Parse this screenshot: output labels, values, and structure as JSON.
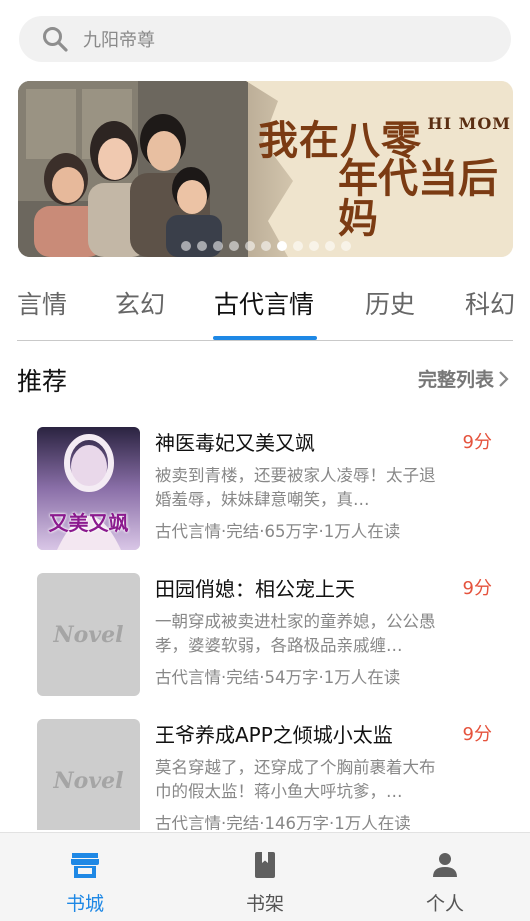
{
  "search": {
    "placeholder": "九阳帝尊",
    "icon": "search-icon"
  },
  "banner": {
    "title_line1": "我在八零",
    "title_line2": "年代当后妈",
    "subtitle": "HI MOM",
    "dots_count": 11,
    "active_dot": 6
  },
  "tabs": [
    {
      "label": "言情"
    },
    {
      "label": "玄幻"
    },
    {
      "label": "古代言情",
      "active": true
    },
    {
      "label": "历史"
    },
    {
      "label": "科幻"
    }
  ],
  "section": {
    "title": "推荐",
    "more": "完整列表"
  },
  "books": [
    {
      "title": "神医毒妃又美又飒",
      "score": "9分",
      "desc": "被卖到青楼，还要被家人凌辱！太子退婚羞辱，妹妹肆意嘲笑，真…",
      "meta": "古代言情·完结·65万字·1万人在读",
      "cover_text": "又美又飒"
    },
    {
      "title": "田园俏媳：相公宠上天",
      "score": "9分",
      "desc": "一朝穿成被卖进杜家的童养媳，公公愚孝，婆婆软弱，各路极品亲戚缠…",
      "meta": "古代言情·完结·54万字·1万人在读",
      "cover_text": "Novel"
    },
    {
      "title": "王爷养成APP之倾城小太监",
      "score": "9分",
      "desc": "莫名穿越了，还穿成了个胸前裹着大布巾的假太监！蒋小鱼大呼坑爹，…",
      "meta": "古代言情·完结·146万字·1万人在读",
      "cover_text": "Novel"
    }
  ],
  "bottom_nav": [
    {
      "label": "书城",
      "icon": "store-icon",
      "active": true
    },
    {
      "label": "书架",
      "icon": "bookshelf-icon"
    },
    {
      "label": "个人",
      "icon": "person-icon"
    }
  ],
  "colors": {
    "accent": "#1e88e5",
    "score": "#e5533d",
    "banner_title": "#7b3b13"
  }
}
